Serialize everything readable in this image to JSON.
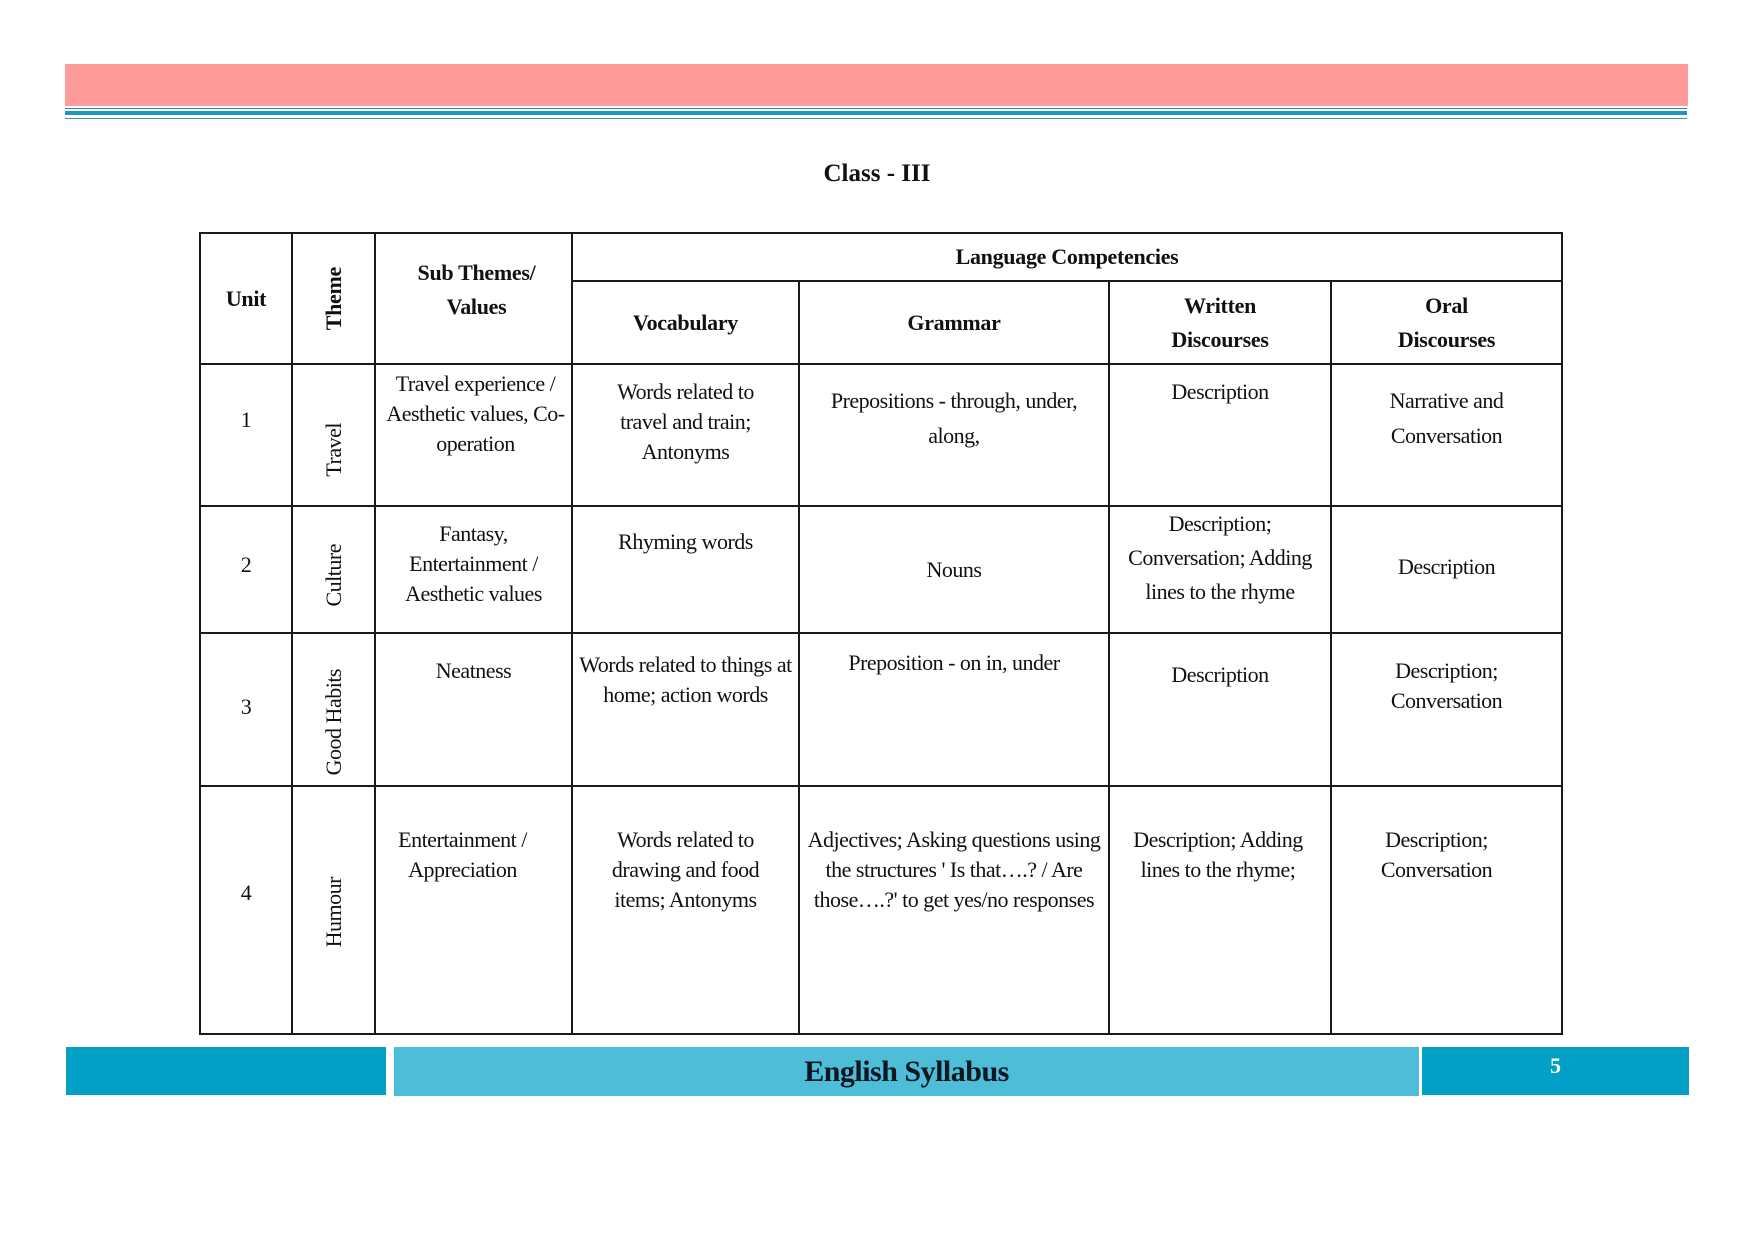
{
  "page_title": "Class - III",
  "table": {
    "headers": {
      "unit": "Unit",
      "theme": "Theme",
      "sub_themes": "Sub Themes/ Values",
      "language_competencies": "Language Competencies",
      "vocabulary": "Vocabulary",
      "grammar": "Grammar",
      "written": "Written Discourses",
      "oral": "Oral Discourses"
    },
    "rows": [
      {
        "unit": "1",
        "theme": "Travel",
        "sub_themes": "Travel experience / Aesthetic values, Co-operation",
        "vocabulary": "Words related to travel and train; Antonyms",
        "grammar": "Prepositions - through, under, along,",
        "written": "Description",
        "oral": "Narrative and Conversation"
      },
      {
        "unit": "2",
        "theme": "Culture",
        "sub_themes": "Fantasy, Entertainment / Aesthetic values",
        "vocabulary": "Rhyming words",
        "grammar": "Nouns",
        "written": "Description; Conversation; Adding lines to the rhyme",
        "oral": "Description"
      },
      {
        "unit": "3",
        "theme": "Good Habits",
        "sub_themes": "Neatness",
        "vocabulary": "Words related to things at home; action words",
        "grammar": "Preposition - on in, under",
        "written": "Description",
        "oral": "Description; Conversation"
      },
      {
        "unit": "4",
        "theme": "Humour",
        "sub_themes": "Entertainment / Appreciation",
        "vocabulary": "Words related to drawing and food items; Antonyms",
        "grammar": "Adjectives; Asking questions using the structures ' Is that….? / Are those….?' to get yes/no responses",
        "written": "Description; Adding lines to the rhyme;",
        "oral": "Description; Conversation"
      }
    ]
  },
  "footer": {
    "title": "English Syllabus",
    "page_number": "5"
  },
  "colors": {
    "header_band": "#ff9b9b",
    "accent_blue": "#02a0c6",
    "footer_mid": "#4dbdd8"
  }
}
